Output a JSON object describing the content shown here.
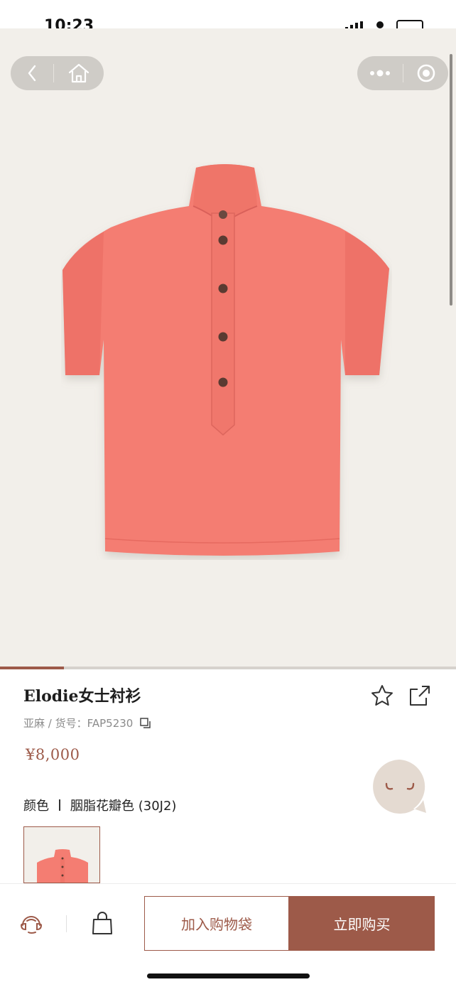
{
  "status_bar": {
    "time": "10:23"
  },
  "nav": {
    "back_icon": "chevron-left-icon",
    "home_icon": "home-icon",
    "more_icon": "more-dots-icon",
    "close_icon": "target-close-icon"
  },
  "gallery": {
    "image": "coral-linen-shirt",
    "current_index_fraction": 0.14
  },
  "product": {
    "title": "Elodie女士衬衫",
    "meta": "亚麻 / 货号：FAP5230",
    "price": "¥8,000",
    "color_label": "颜色",
    "color_value": "胭脂花瓣色 (30J2)"
  },
  "actions": {
    "favorite_icon": "star-icon",
    "share_icon": "share-icon",
    "copy_icon": "copy-icon",
    "service_icon": "customer-service-icon",
    "bag_icon": "shopping-bag-icon",
    "add_to_bag": "加入购物袋",
    "buy_now": "立即购买"
  },
  "colors": {
    "accent": "#9d5a49",
    "hero_bg": "#f2efea",
    "shirt": "#f47d72"
  }
}
